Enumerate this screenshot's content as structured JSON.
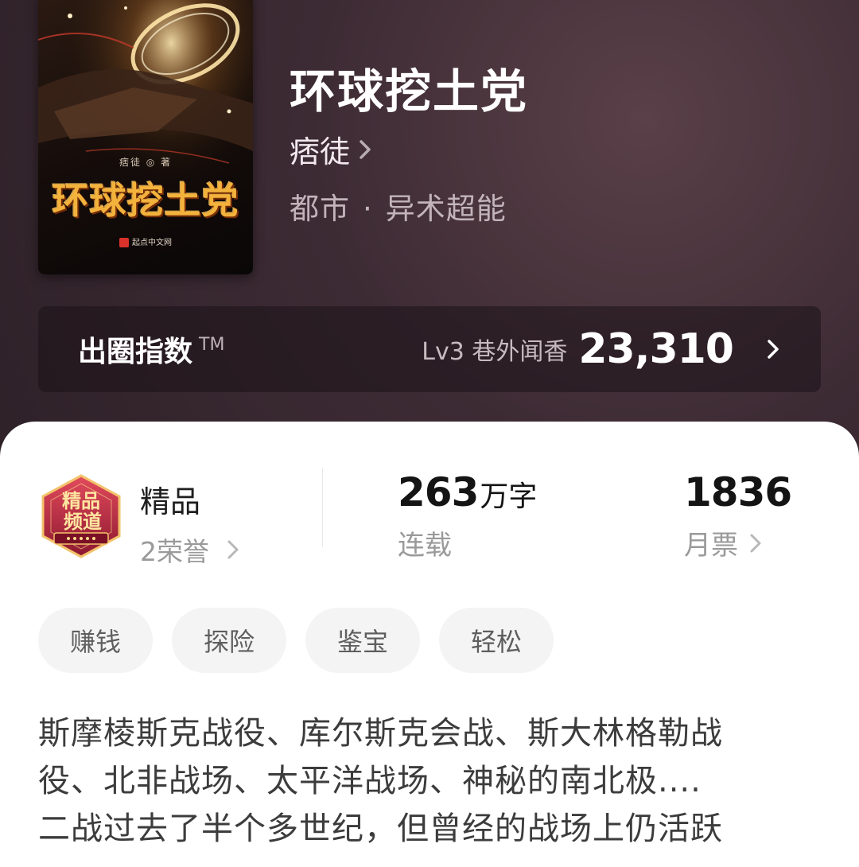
{
  "book": {
    "title": "环球挖土党",
    "author": "痞徒",
    "category": "都市",
    "separator": "·",
    "subcategory": "异术超能"
  },
  "cover": {
    "title": "环球挖土党",
    "author_line": "痞徒 ◎ 著",
    "publisher": "起点中文网",
    "icons": [
      "ring-icon",
      "publisher-logo-icon"
    ]
  },
  "influence": {
    "label": "出圈指数",
    "tm": "TM",
    "level_text": "Lv3 巷外闻香",
    "value": "23,310",
    "icon": "chevron-right-icon"
  },
  "stats": {
    "quality": {
      "badge_text_1": "精品",
      "badge_text_2": "频道",
      "label": "精品",
      "sub": "2荣誉",
      "icon": "quality-badge-icon"
    },
    "words": {
      "number": "263",
      "unit": "万字",
      "status": "连载"
    },
    "tickets": {
      "number": "1836",
      "label": "月票"
    }
  },
  "tags": [
    "赚钱",
    "探险",
    "鉴宝",
    "轻松"
  ],
  "synopsis": [
    "斯摩棱斯克战役、库尔斯克会战、斯大林格勒战",
    "役、北非战场、太平洋战场、神秘的南北极....",
    "二战过去了半个多世纪，但曾经的战场上仍活跃"
  ],
  "colors": {
    "hero_bg": "#3d2b34",
    "cover_title": "#f2b23c",
    "badge_red": "#b8233a",
    "chip_bg": "#f4f4f4"
  }
}
